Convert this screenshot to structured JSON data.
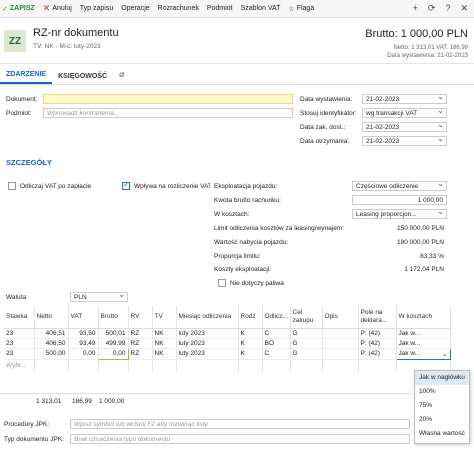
{
  "toolbar": {
    "save": "ZAPISZ",
    "cancel": "Anuluj",
    "items": [
      "Typ zapisu",
      "Operacje",
      "Rozrachunek",
      "Podmiot",
      "Szablon VAT",
      "Flaga"
    ]
  },
  "header": {
    "badge": "ZZ",
    "title": "RZ-nr dokumentu",
    "subtitle": "TV: NK  -  M-c: luty-2023",
    "brutto": "Brutto: 1 000,00 PLN",
    "netto_vat": "Netto: 1 313,01  VAT: 186,99",
    "date": "Data wystawienia: 21-02-2023"
  },
  "tabs": [
    "ZDARZENIE",
    "KSIĘGOWOŚĆ"
  ],
  "form": {
    "dokument_label": "Dokument:",
    "podmiot_label": "Podmiot:",
    "podmiot_placeholder": "Wprowadź kontrahenta...",
    "data_wystawienia_label": "Data wystawienia:",
    "data_wystawienia": "21-02-2023",
    "stosuj_label": "Stosuj identyfikator:",
    "stosuj": "wg transakcji VAT",
    "data_zak_label": "Data zak. dost.:",
    "data_zak": "21-02-2023",
    "data_otrzymania_label": "Data otrzymania:",
    "data_otrzymania": "21-02-2023"
  },
  "details": {
    "title": "SZCZEGÓŁY",
    "odliczaj_label": "Odliczaj VAT po zapłacie",
    "wplywa_label": "Wpływa na rozliczenie VAT",
    "eksploatacja_label": "Eksploatacja pojazdu:",
    "eksploatacja": "Częściowe odliczenie",
    "kwota_label": "Kwota brutto rachunku:",
    "kwota": "1 000,00",
    "w_kosztach_label": "W kosztach:",
    "w_kosztach": "Leasing proporcjon...",
    "limit_label": "Limit odliczenia kosztów za leasing/wynajem:",
    "limit": "150 000,00 PLN",
    "wartosc_label": "Wartość nabycia pojazdu:",
    "wartosc": "180 000,00 PLN",
    "proporcja_label": "Proporcja limitu:",
    "proporcja": "83,33 %",
    "koszty_label": "Koszty eksploatacji:",
    "koszty": "1 172,04 PLN",
    "nie_dotyczy_label": "Nie dotyczy paliwa",
    "waluta_label": "Waluta:",
    "waluta": "PLN"
  },
  "grid": {
    "headers": [
      "Stawka",
      "Netto",
      "VAT",
      "Brutto",
      "RV",
      "TV",
      "Miesiąc odliczenia",
      "Rodz",
      "Odlicz...",
      "Cel zakupu",
      "Opis",
      "Pole na deklara...",
      "W kosztach"
    ],
    "rows": [
      [
        "23",
        "406,51",
        "93,50",
        "500,01",
        "RZ",
        "NK",
        "luty 2023",
        "K",
        "C",
        "G",
        "",
        "P: (42)",
        "Jak w..."
      ],
      [
        "23",
        "406,50",
        "93,49",
        "499,99",
        "RZ",
        "NK",
        "luty 2023",
        "K",
        "BO",
        "G",
        "",
        "P: (42)",
        "Jak w..."
      ],
      [
        "23",
        "500,00",
        "0,00",
        "0,00",
        "RZ",
        "NK",
        "luty 2023",
        "K",
        "C",
        "G",
        "",
        "P: (42)",
        "Jak w..."
      ]
    ],
    "new_row_placeholder": "Wybi...",
    "totals": {
      "netto": "1 313,01",
      "vat": "186,99",
      "brutto": "1 000,00"
    }
  },
  "popup_options": [
    "Jak w nagłówku",
    "100%",
    "75%",
    "20%",
    "Własna wartość"
  ],
  "footer": {
    "procedury_label": "Procedury JPK:",
    "procedury_placeholder": "Wpisz symbol lub wciśnij F2 aby rozwinąć listę",
    "typ_label": "Typ dokumentu JPK:",
    "typ_placeholder": "Brak oznaczenia typu dokumentu"
  },
  "colors": {
    "accent": "#1565c0",
    "save": "#1f8a3a",
    "highlight": "#fffbc8"
  },
  "icons": [
    "save-icon",
    "close-icon",
    "flag-icon",
    "add-icon",
    "refresh-icon",
    "help-icon",
    "close-window-icon",
    "paperclip-icon",
    "dropdown-icon",
    "calendar-icon"
  ]
}
